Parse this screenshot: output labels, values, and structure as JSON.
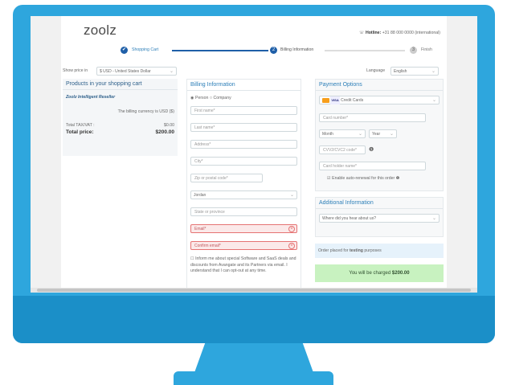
{
  "brand": "zoolz",
  "hotline": {
    "label": "Hotline:",
    "value": "+31 88 000 0000 (international)"
  },
  "steps": [
    {
      "num": "✔",
      "label": "Shopping Cart"
    },
    {
      "num": "2",
      "label": "Billing Information"
    },
    {
      "num": "3",
      "label": "Finish"
    }
  ],
  "price_bar": {
    "label": "Show price in",
    "currency": "$ USD - United States Dollar",
    "language_label": "Language",
    "language": "English"
  },
  "cart": {
    "title": "Products in your shopping cart",
    "product": "Zoolz Intelligent Reseller",
    "currency_note": "The billing currency is USD ($)",
    "tax_label": "Total TAX/VAT :",
    "tax_value": "$0.00",
    "total_label": "Total price:",
    "total_value": "$200.00"
  },
  "billing": {
    "title": "Billing Information",
    "radio_person": "Person",
    "radio_company": "Company",
    "first_name": "First name*",
    "last_name": "Last name*",
    "address": "Address*",
    "city": "City*",
    "zip": "Zip or postal code*",
    "country": "Jordan",
    "state": "State or province",
    "email": "Email*",
    "confirm_email": "Confirm email*",
    "consent": "Inform me about special Software and SaaS deals and discounts from Avangate and its Partners via email. I understand that I can opt-out at any time."
  },
  "payment": {
    "title": "Payment Options",
    "method": "Credit Cards",
    "card_number": "Card number*",
    "month": "Month",
    "year": "Year",
    "cvv": "CVV2/CVC2 code*",
    "holder": "Card holder name*",
    "auto_renew": "Enable auto-renewal for this order"
  },
  "additional": {
    "title": "Additional Information",
    "source": "Where did you hear about us?",
    "testing_pre": "Order placed for",
    "testing_word": "testing",
    "testing_post": "purposes",
    "charge_pre": "You will be charged",
    "charge_value": "$200.00"
  },
  "colors": {
    "accent": "#2ea6dd",
    "heading": "#2d7fb8",
    "success": "#c8f2c0"
  }
}
